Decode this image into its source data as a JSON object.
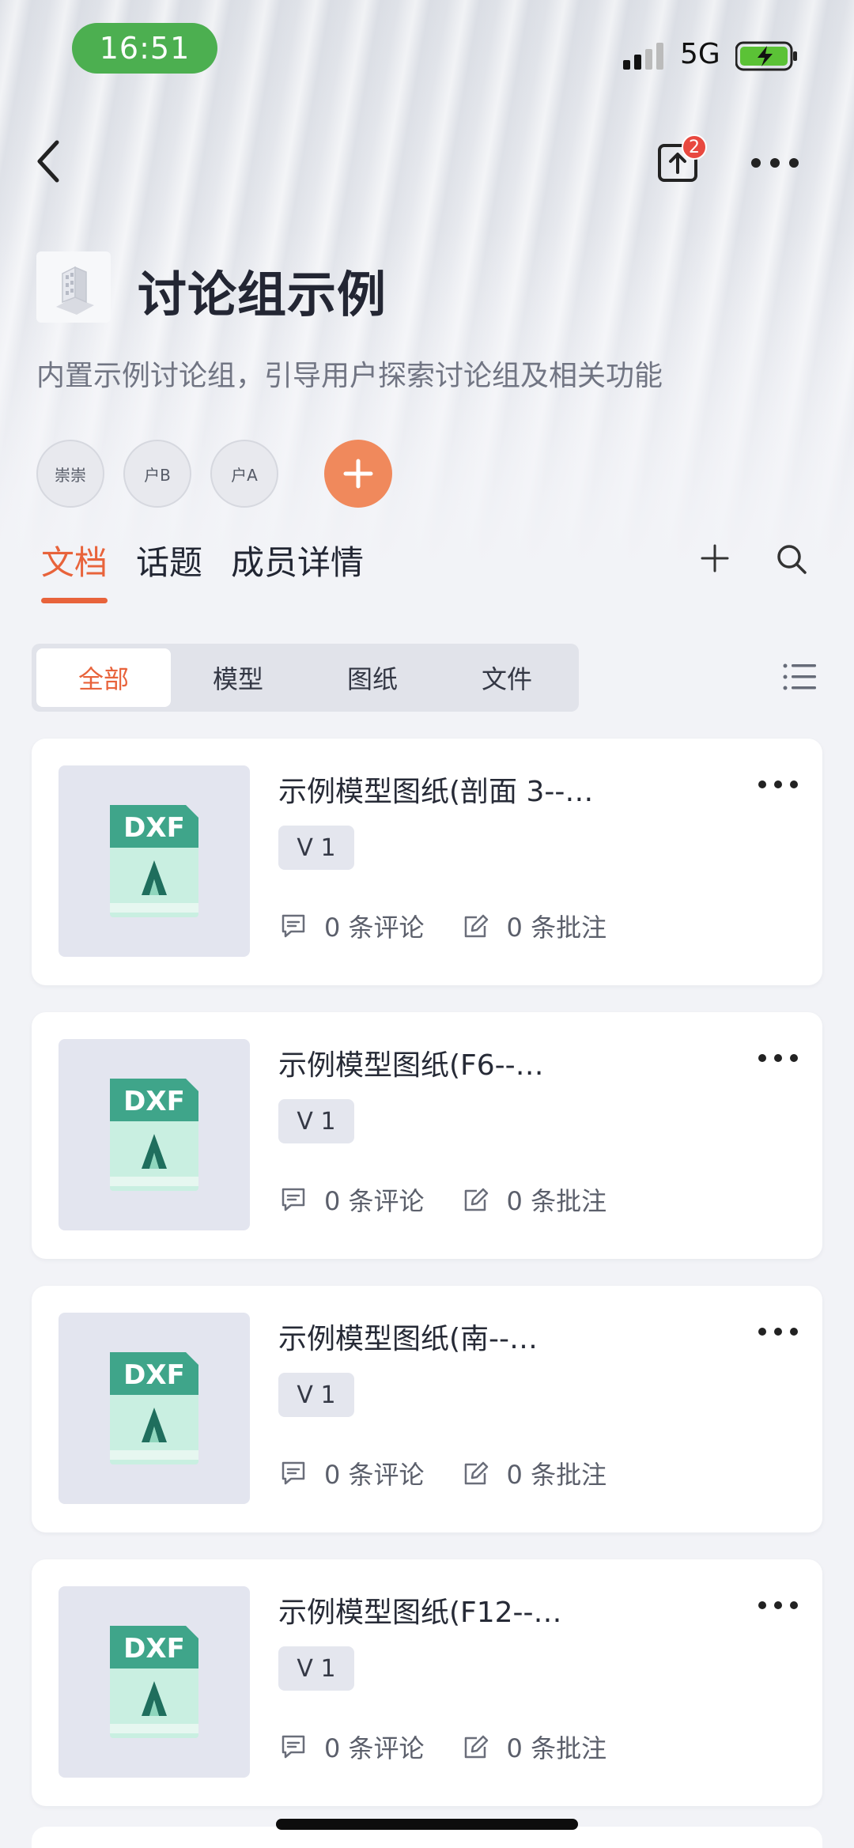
{
  "status_bar": {
    "time": "16:51",
    "network": "5G"
  },
  "nav": {
    "upload_badge": "2"
  },
  "group": {
    "title": "讨论组示例",
    "description": "内置示例讨论组，引导用户探索讨论组及相关功能",
    "members": [
      "崇崇",
      "户B",
      "户A"
    ]
  },
  "tabs": [
    {
      "label": "文档",
      "active": true
    },
    {
      "label": "话题",
      "active": false
    },
    {
      "label": "成员详情",
      "active": false
    }
  ],
  "filters": [
    {
      "label": "全部",
      "active": true
    },
    {
      "label": "模型",
      "active": false
    },
    {
      "label": "图纸",
      "active": false
    },
    {
      "label": "文件",
      "active": false
    }
  ],
  "documents": [
    {
      "name": "示例模型图纸(剖面 3--…",
      "file_type": "DXF",
      "version": "V 1",
      "comments": "0 条评论",
      "annotations": "0 条批注"
    },
    {
      "name": "示例模型图纸(F6--…",
      "file_type": "DXF",
      "version": "V 1",
      "comments": "0 条评论",
      "annotations": "0 条批注"
    },
    {
      "name": "示例模型图纸(南--…",
      "file_type": "DXF",
      "version": "V 1",
      "comments": "0 条评论",
      "annotations": "0 条批注"
    },
    {
      "name": "示例模型图纸(F12--…",
      "file_type": "DXF",
      "version": "V 1",
      "comments": "0 条评论",
      "annotations": "0 条批注"
    }
  ],
  "colors": {
    "accent": "#e8633b",
    "time_pill": "#4caf50",
    "file_icon": "#3fa58a"
  }
}
